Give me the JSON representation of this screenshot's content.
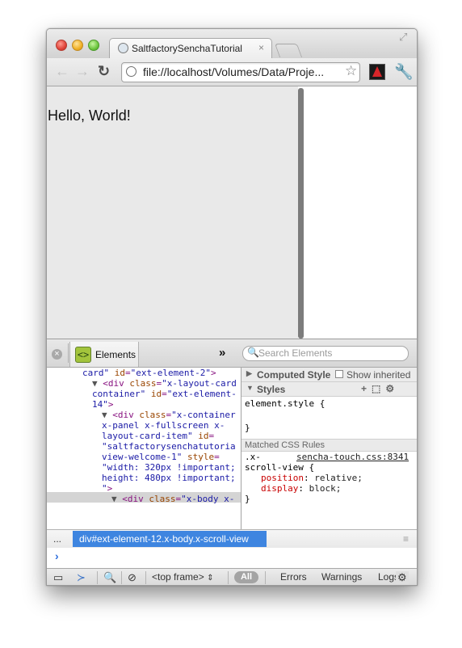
{
  "browser": {
    "tab_title": "SaltfactorySenchaTutorial",
    "tab_close": "×",
    "url": "file://localhost/Volumes/Data/Proje..."
  },
  "page": {
    "hello_text": "Hello, World!"
  },
  "devtools": {
    "close_glyph": "×",
    "panel_label": "Elements",
    "more_panels": "»",
    "search_placeholder": "Search Elements",
    "dom": {
      "l1_text": "card\"",
      "l1_attr": "id",
      "l1_val": "\"ext-element-2\"",
      "l1_end": ">",
      "l2_tri": "▼",
      "l2_open": "<div",
      "l2_attr": "class",
      "l2_val": "\"x-layout-card",
      "l3_val": "container\"",
      "l3_attr": "id",
      "l3_val2": "\"ext-element-",
      "l4_val": "14\"",
      "l4_end": ">",
      "l5_tri": "▼",
      "l5_open": "<div",
      "l5_attr": "class",
      "l5_val": "\"x-container",
      "l6_val": "x-panel x-fullscreen x-",
      "l7_val": "layout-card-item\"",
      "l7_attr": "id",
      "l8_val": "\"saltfactorysenchatutoria",
      "l9_val": "view-welcome-1\"",
      "l9_attr": "style",
      "l10_val": "\"width: 320px !important;",
      "l11_val": "height: 480px !important;",
      "l12_val": "\"",
      "l12_end": ">",
      "l13_tri": "▼",
      "l13_open": "<div",
      "l13_attr": "class",
      "l13_val": "\"x-body x-"
    },
    "sidebar": {
      "computed_title": "Computed Style",
      "show_inherited": "Show inherited",
      "styles_title": "Styles",
      "element_style": "element.style {",
      "close_brace": "}",
      "matched_title": "Matched CSS Rules",
      "rule_selector_1": ".x-",
      "rule_source": "sencha-touch.css:8341",
      "rule_selector_2": "scroll-view {",
      "prop1_name": "position",
      "prop1_value": "relative;",
      "prop2_name": "display",
      "prop2_value": "block;",
      "rule_close": "}"
    },
    "breadcrumbs": {
      "more": "...",
      "selected": "div#ext-element-12.x-body.x-scroll-view"
    },
    "console_prompt": "›",
    "status": {
      "frame": "<top frame>",
      "all": "All",
      "errors": "Errors",
      "warnings": "Warnings",
      "logs": "Logs"
    }
  }
}
